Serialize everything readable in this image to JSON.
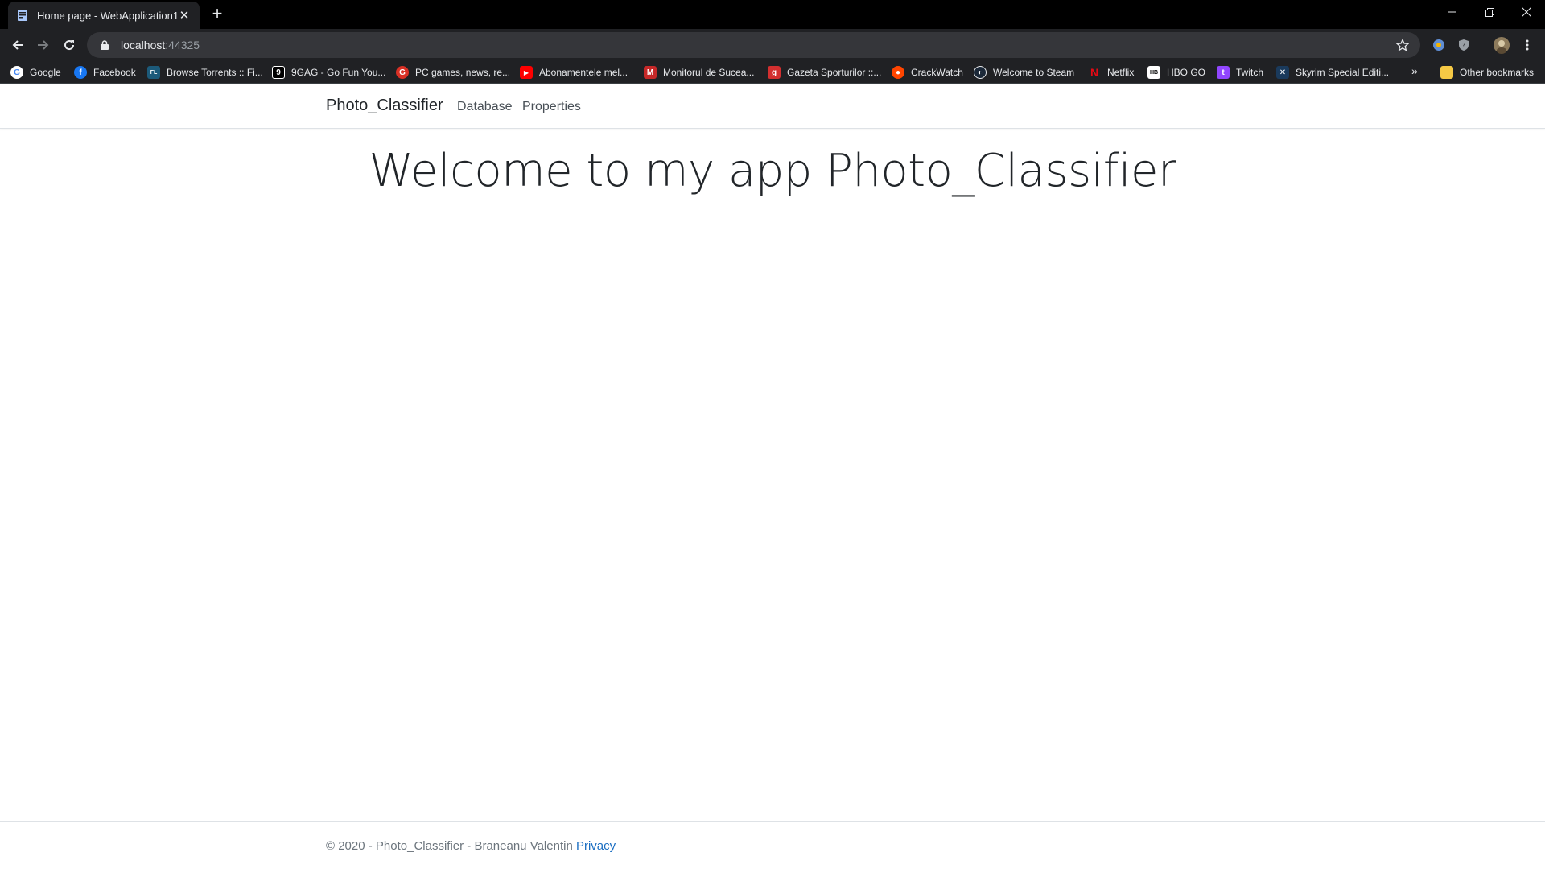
{
  "browser": {
    "tab_title": "Home page - WebApplication1",
    "url_host": "localhost",
    "url_port": ":44325",
    "bookmarks": [
      {
        "label": "Google",
        "icon": "google-icon",
        "color": "#4285f4"
      },
      {
        "label": "Facebook",
        "icon": "facebook-icon",
        "color": "#1877f2"
      },
      {
        "label": "Browse Torrents :: Fi...",
        "icon": "filelist-icon",
        "color": "#1c5a7a"
      },
      {
        "label": "9GAG - Go Fun You...",
        "icon": "9gag-icon",
        "color": "#000000"
      },
      {
        "label": "PC games, news, re...",
        "icon": "pcgames-icon",
        "color": "#d93025"
      },
      {
        "label": "Abonamentele mel...",
        "icon": "youtube-icon",
        "color": "#ff0000"
      },
      {
        "label": "Monitorul de Sucea...",
        "icon": "monitorul-icon",
        "color": "#c62828"
      },
      {
        "label": "Gazeta Sporturilor ::...",
        "icon": "gazeta-icon",
        "color": "#d32f2f"
      },
      {
        "label": "CrackWatch",
        "icon": "reddit-icon",
        "color": "#ff4500"
      },
      {
        "label": "Welcome to Steam",
        "icon": "steam-icon",
        "color": "#1b2838"
      },
      {
        "label": "Netflix",
        "icon": "netflix-icon",
        "color": "#e50914"
      },
      {
        "label": "HBO GO",
        "icon": "hbogo-icon",
        "color": "#ffffff"
      },
      {
        "label": "Twitch",
        "icon": "twitch-icon",
        "color": "#9146ff"
      },
      {
        "label": "Skyrim Special Editi...",
        "icon": "skyrim-icon",
        "color": "#ffffff"
      }
    ],
    "other_bookmarks": "Other bookmarks"
  },
  "app": {
    "brand": "Photo_Classifier",
    "nav": [
      "Database",
      "Properties"
    ],
    "hero_title": "Welcome to my app Photo_Classifier",
    "footer_text": "© 2020 - Photo_Classifier - Braneanu Valentin ",
    "footer_link": "Privacy"
  }
}
